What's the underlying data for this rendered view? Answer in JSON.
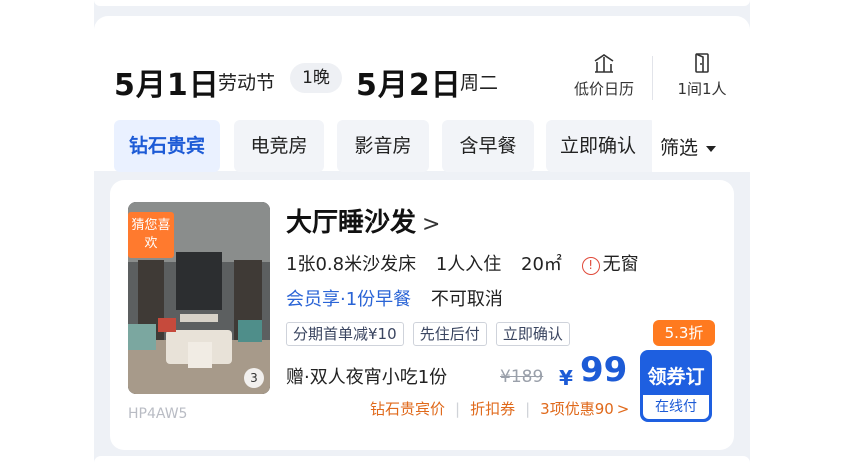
{
  "search_bar": {
    "checkin_date": "5月1日",
    "checkin_note": "劳动节",
    "nights": "1晚",
    "checkout_date": "5月2日",
    "checkout_weekday": "周二",
    "calendar_label": "低价日历",
    "room_guest_label": "1间1人"
  },
  "filter_chips": [
    {
      "label": "钻石贵宾",
      "active": true
    },
    {
      "label": "电竞房",
      "active": false
    },
    {
      "label": "影音房",
      "active": false
    },
    {
      "label": "含早餐",
      "active": false
    },
    {
      "label": "立即确认",
      "active": false
    }
  ],
  "filter_button": "筛选",
  "room": {
    "photo_badge": "猜您喜欢",
    "photo_count": "3",
    "photo_code": "HP4AW5",
    "title": "大厅睡沙发",
    "title_chevron": ">",
    "bed": "1张0.8米沙发床",
    "occupancy": "1人入住",
    "area": "20㎡",
    "window_icon": "!",
    "window": "无窗",
    "member_benefit": "会员享·1份早餐",
    "cancel_policy": "不可取消",
    "tags": [
      "分期首单减¥10",
      "先住后付",
      "立即确认"
    ],
    "gift": "赠·双人夜宵小吃1份",
    "original_price": "¥189",
    "currency": "¥",
    "price": "99",
    "discount": "5.3折",
    "book_label": "领券订",
    "book_sub": "在线付",
    "promos": [
      "钻石贵宾价",
      "折扣券",
      "3项优惠90"
    ],
    "promo_arrow": ">"
  },
  "colors": {
    "accent_blue": "#1d5bd6",
    "discount_orange": "#ff7a1f",
    "promo_orange": "#e06a1c",
    "background": "#eef1f6"
  }
}
